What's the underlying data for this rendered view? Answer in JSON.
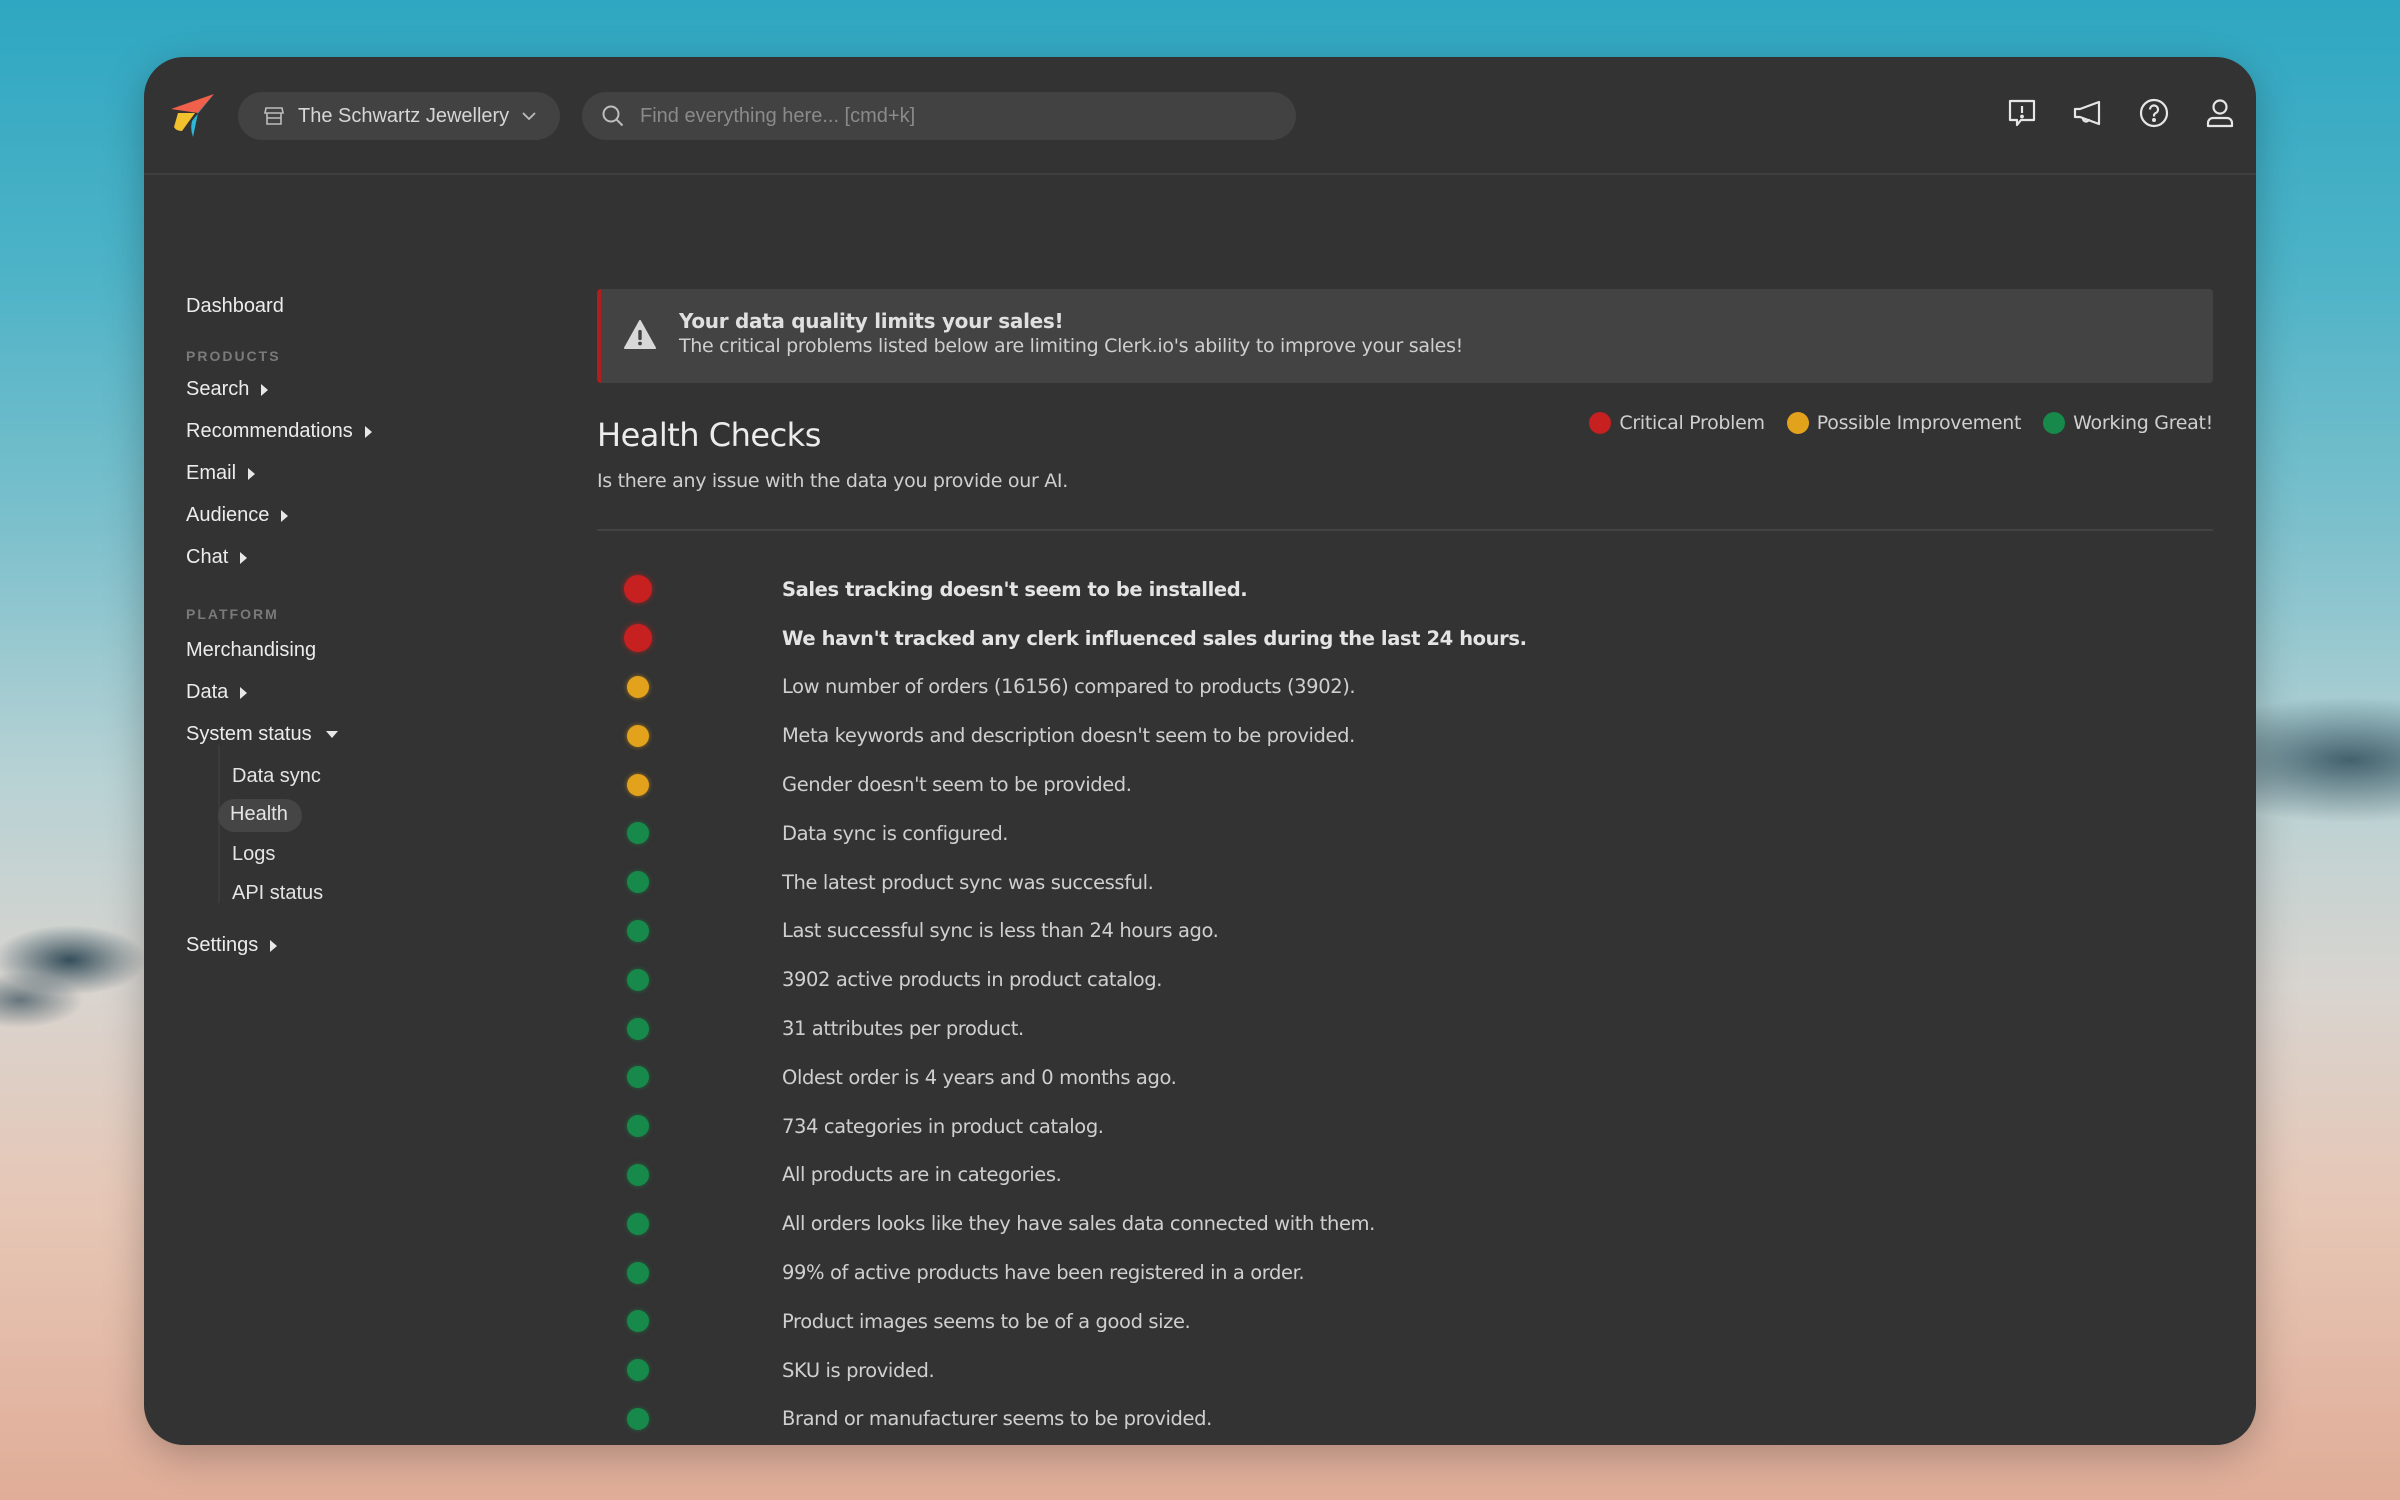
{
  "colors": {
    "critical": "#c62020",
    "possible": "#e3a21c",
    "great": "#17894a",
    "alert_border": "#b21d1d"
  },
  "topbar": {
    "logo": "clerk-rocket-logo",
    "store_selector": {
      "icon": "store-icon",
      "label": "The Schwartz Jewellery",
      "chevron": "chevron-down-icon"
    },
    "search": {
      "icon": "search-icon",
      "value": "",
      "placeholder": "Find everything here... [cmd+k]"
    },
    "icons": [
      "feedback-icon",
      "megaphone-icon",
      "help-icon",
      "user-icon"
    ]
  },
  "sidebar": {
    "dashboard": "Dashboard",
    "sections": [
      {
        "label": "PRODUCTS",
        "items": [
          {
            "label": "Search",
            "expandable": true
          },
          {
            "label": "Recommendations",
            "expandable": true
          },
          {
            "label": "Email",
            "expandable": true
          },
          {
            "label": "Audience",
            "expandable": true
          },
          {
            "label": "Chat",
            "expandable": true
          }
        ]
      },
      {
        "label": "PLATFORM",
        "items": [
          {
            "label": "Merchandising",
            "expandable": false
          },
          {
            "label": "Data",
            "expandable": true
          },
          {
            "label": "System status",
            "expanded": true,
            "children": [
              {
                "label": "Data sync"
              },
              {
                "label": "Health",
                "active": true
              },
              {
                "label": "Logs"
              },
              {
                "label": "API status"
              }
            ]
          },
          {
            "label": "Settings",
            "expandable": true
          }
        ]
      }
    ]
  },
  "alert": {
    "icon": "warning-icon",
    "title": "Your data quality limits your sales!",
    "body": "The critical problems listed below are limiting Clerk.io's ability to improve your sales!"
  },
  "main": {
    "title": "Health Checks",
    "subtitle": "Is there any issue with the data you provide our AI.",
    "legend": [
      {
        "status": "critical",
        "label": "Critical Problem"
      },
      {
        "status": "possible",
        "label": "Possible Improvement"
      },
      {
        "status": "great",
        "label": "Working Great!"
      }
    ],
    "checks": [
      {
        "status": "critical",
        "text": "Sales tracking doesn't seem to be installed."
      },
      {
        "status": "critical",
        "text": "We havn't tracked any clerk influenced sales during the last 24 hours."
      },
      {
        "status": "possible",
        "text": "Low number of orders (16156) compared to products (3902)."
      },
      {
        "status": "possible",
        "text": "Meta keywords and description doesn't seem to be provided."
      },
      {
        "status": "possible",
        "text": "Gender doesn't seem to be provided."
      },
      {
        "status": "great",
        "text": "Data sync is configured."
      },
      {
        "status": "great",
        "text": "The latest product sync was successful."
      },
      {
        "status": "great",
        "text": "Last successful sync is less than 24 hours ago."
      },
      {
        "status": "great",
        "text": "3902 active products in product catalog."
      },
      {
        "status": "great",
        "text": "31 attributes per product."
      },
      {
        "status": "great",
        "text": "Oldest order is 4 years and 0 months ago."
      },
      {
        "status": "great",
        "text": "734 categories in product catalog."
      },
      {
        "status": "great",
        "text": "All products are in categories."
      },
      {
        "status": "great",
        "text": "All orders looks like they have sales data connected with them."
      },
      {
        "status": "great",
        "text": "99% of active products have been registered in a order."
      },
      {
        "status": "great",
        "text": "Product images seems to be of a good size."
      },
      {
        "status": "great",
        "text": "SKU is provided."
      },
      {
        "status": "great",
        "text": "Brand or manufacturer seems to be provided."
      }
    ]
  }
}
